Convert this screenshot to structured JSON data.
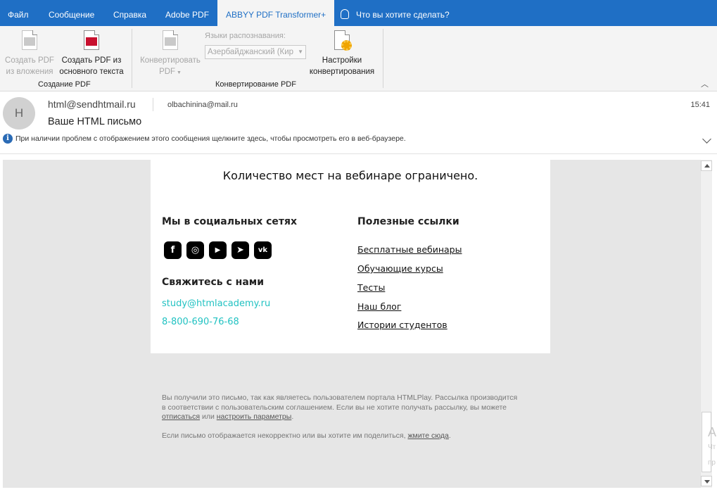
{
  "tabs": [
    {
      "label": "Файл",
      "active": false
    },
    {
      "label": "Сообщение",
      "active": false
    },
    {
      "label": "Справка",
      "active": false
    },
    {
      "label": "Adobe PDF",
      "active": false
    },
    {
      "label": "ABBYY PDF Transformer+",
      "active": true
    }
  ],
  "tell_me": "Что вы хотите сделать?",
  "ribbon": {
    "btn_pdf_from_attachment": [
      "Создать PDF",
      "из вложения"
    ],
    "btn_pdf_from_text": [
      "Создать PDF из",
      "основного текста"
    ],
    "group_create": "Создание PDF",
    "btn_convert": [
      "Конвертировать",
      "PDF"
    ],
    "lang_label": "Языки распознавания:",
    "lang_value": "Азербайджанский (Кир",
    "btn_settings": [
      "Настройки",
      "конвертирования"
    ],
    "group_convert": "Конвертирование PDF"
  },
  "message": {
    "avatar_letter": "H",
    "from": "html@sendhtmail.ru",
    "to": "olbachinina@mail.ru",
    "time": "15:41",
    "subject": "Ваше HTML письмо",
    "info_bar": "При наличии проблем с отображением этого сообщения щелкните здесь, чтобы просмотреть его в веб-браузере."
  },
  "email": {
    "headline": "Количество мест на вебинаре ограничено.",
    "social_title": "Мы в социальных сетях",
    "social_icons": [
      "facebook-icon",
      "instagram-icon",
      "youtube-icon",
      "telegram-icon",
      "vk-icon"
    ],
    "social_glyphs": [
      "f",
      "◎",
      "▶",
      "➤",
      "vk"
    ],
    "contact_title": "Свяжитесь с нами",
    "contact_email": "study@htmlacademy.ru",
    "contact_phone": "8-800-690-76-68",
    "links_title": "Полезные ссылки",
    "links": [
      "Бесплатные вебинары",
      "Обучающие курсы",
      "Тесты",
      "Наш блог",
      "Истории студентов"
    ],
    "footer_1_text": "Вы получили это письмо, так как являетесь пользователем портала HTMLPlay. Рассылка производится в соответствии с пользовательским соглашением. Если вы не хотите получать рассылку, вы можете",
    "footer_1_link_unsub": "отписаться",
    "footer_1_or": "или",
    "footer_1_link_settings": "настроить параметры",
    "footer_2_text": "Если письмо отображается некорректно или вы хотите им поделиться,",
    "footer_2_link": "жмите сюда"
  },
  "edge_text": [
    "А",
    "Чт",
    "пр"
  ],
  "colors": {
    "tabbar": "#1f6fc5",
    "accent_link": "#22c2c2",
    "pdf_red": "#c8102e"
  }
}
